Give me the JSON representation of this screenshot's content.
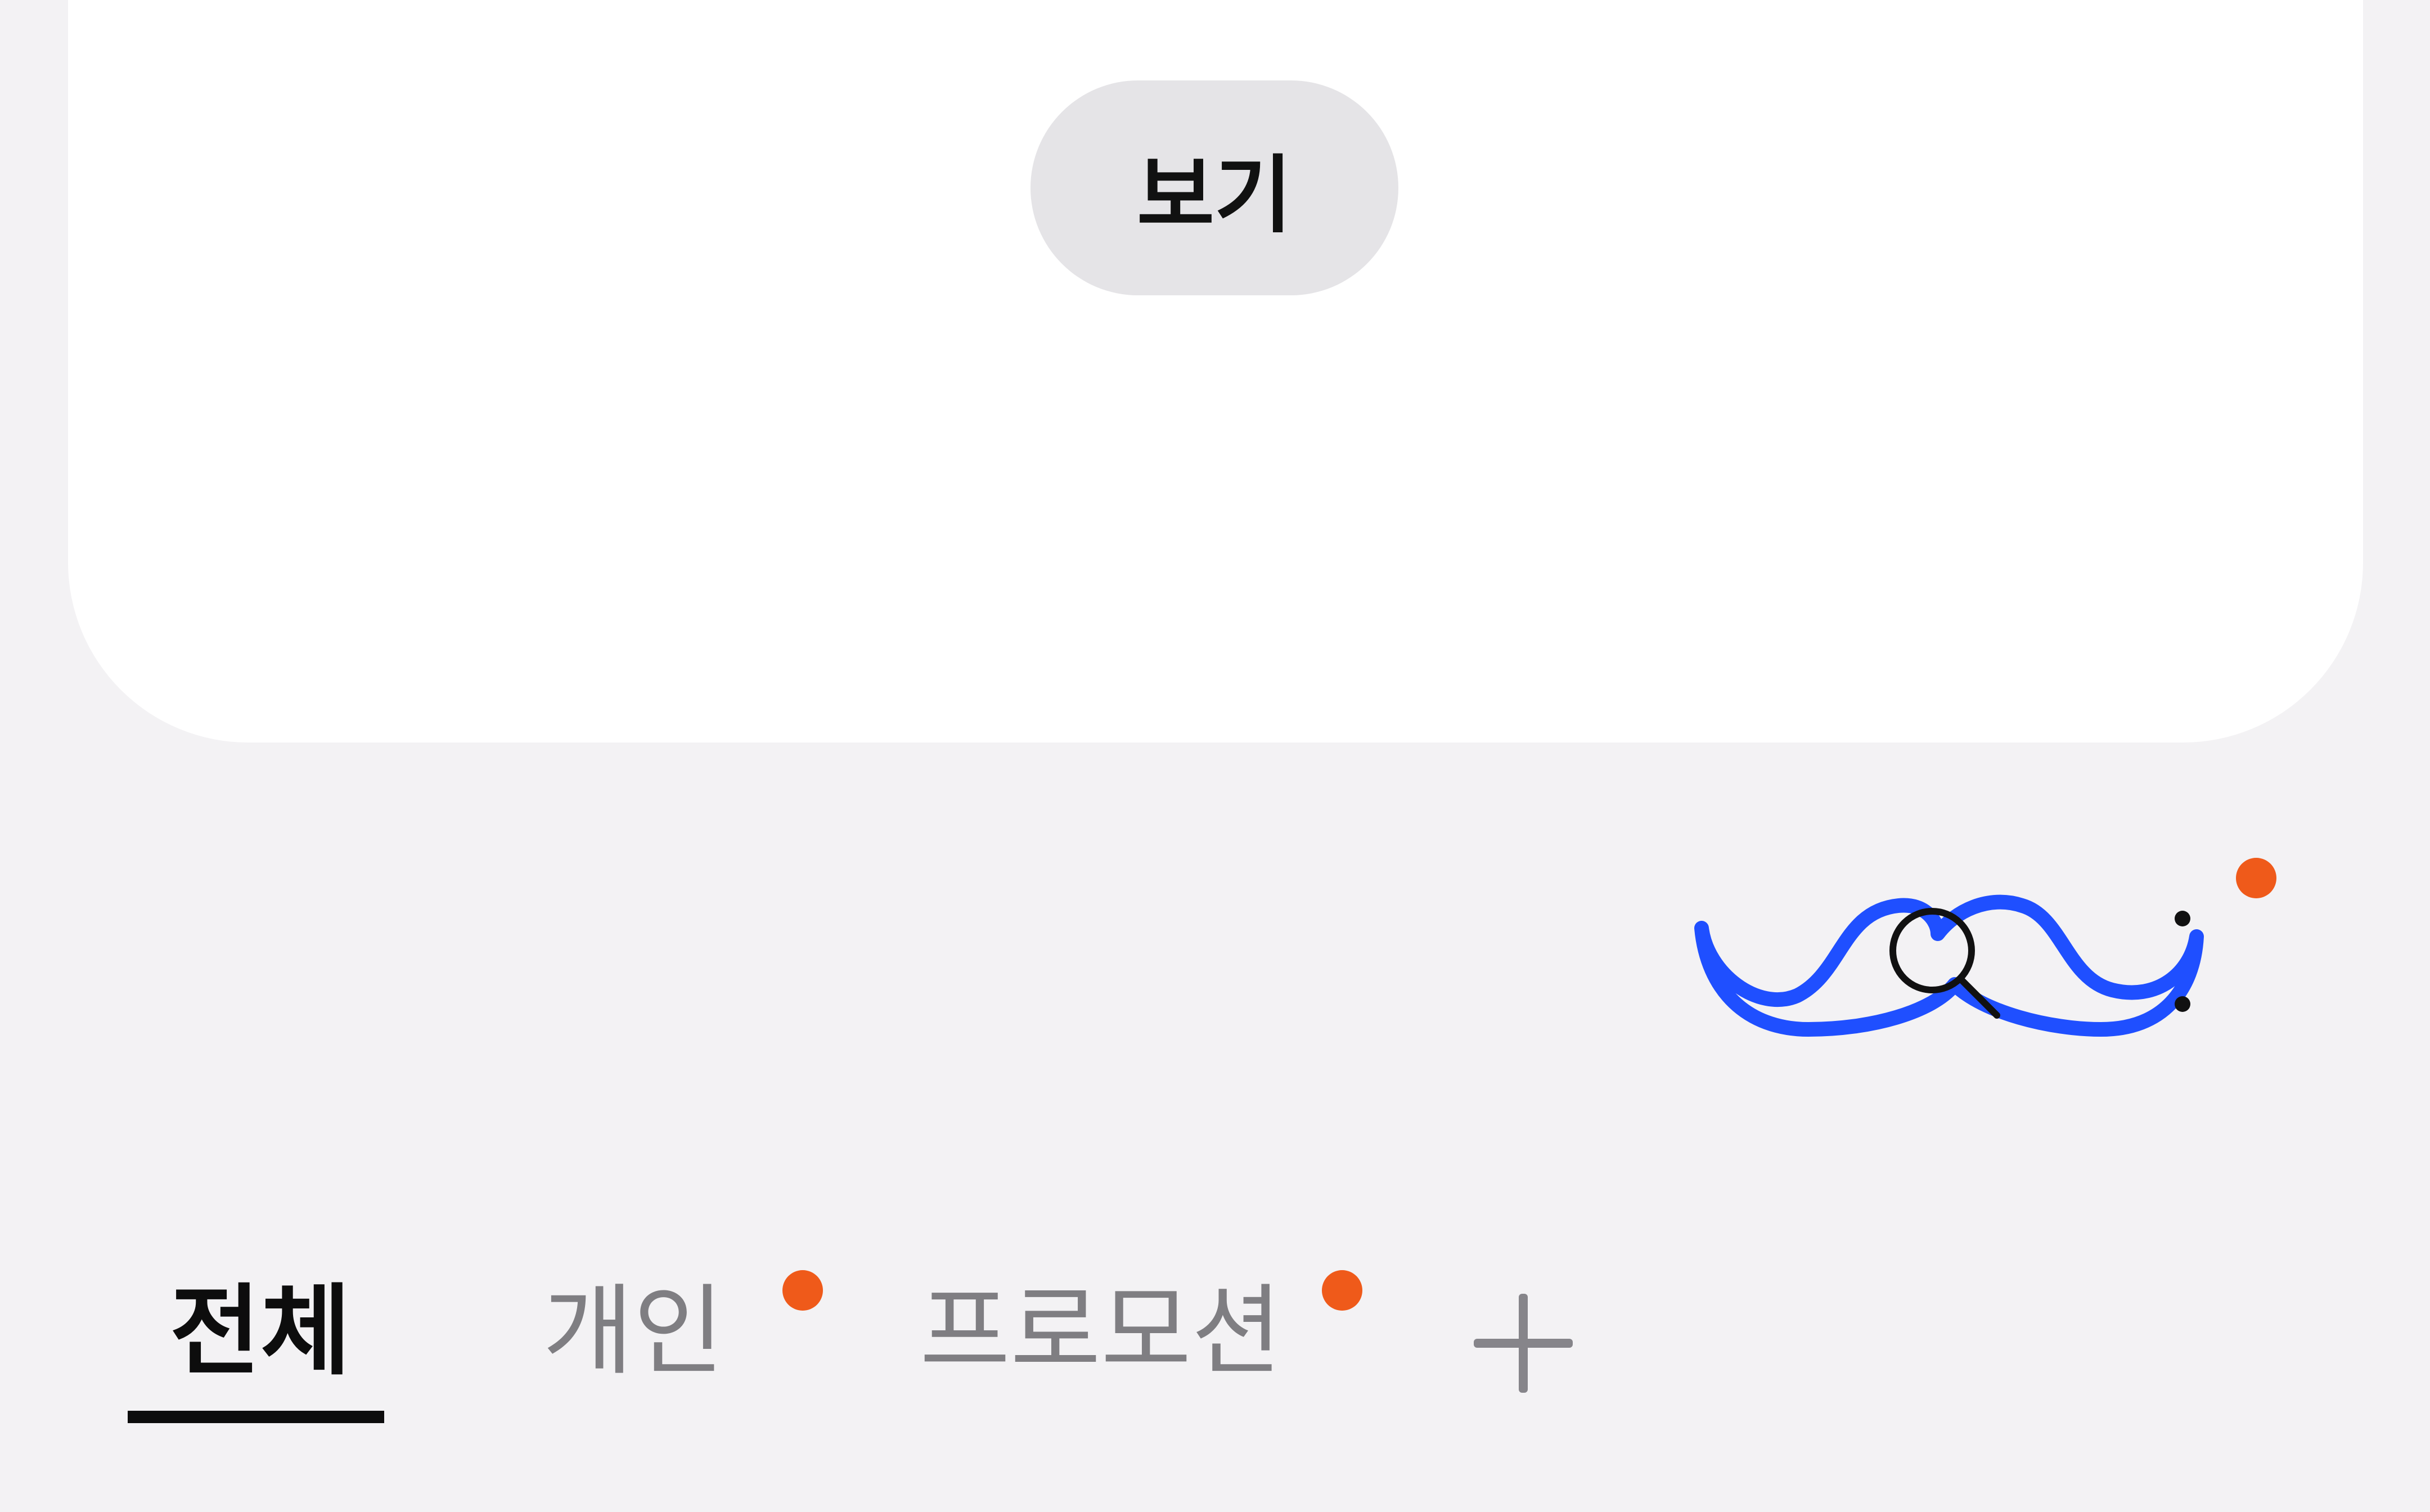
{
  "card": {
    "view_button_label": "보기"
  },
  "search_icon": {
    "name": "mustache-search-icon",
    "has_notification": true
  },
  "tabs": [
    {
      "label": "전체",
      "active": true,
      "has_notification": false
    },
    {
      "label": "개인",
      "active": false,
      "has_notification": true
    },
    {
      "label": "프로모션",
      "active": false,
      "has_notification": true
    }
  ],
  "add_tab": {
    "icon": "plus-icon"
  },
  "colors": {
    "background": "#f3f2f4",
    "card": "#ffffff",
    "button": "#e5e4e7",
    "notification_dot": "#ef5a1a",
    "mustache_stroke": "#1f4fff",
    "active_tab_text": "#0d0d0d",
    "inactive_tab_text": "#7f7e82"
  }
}
